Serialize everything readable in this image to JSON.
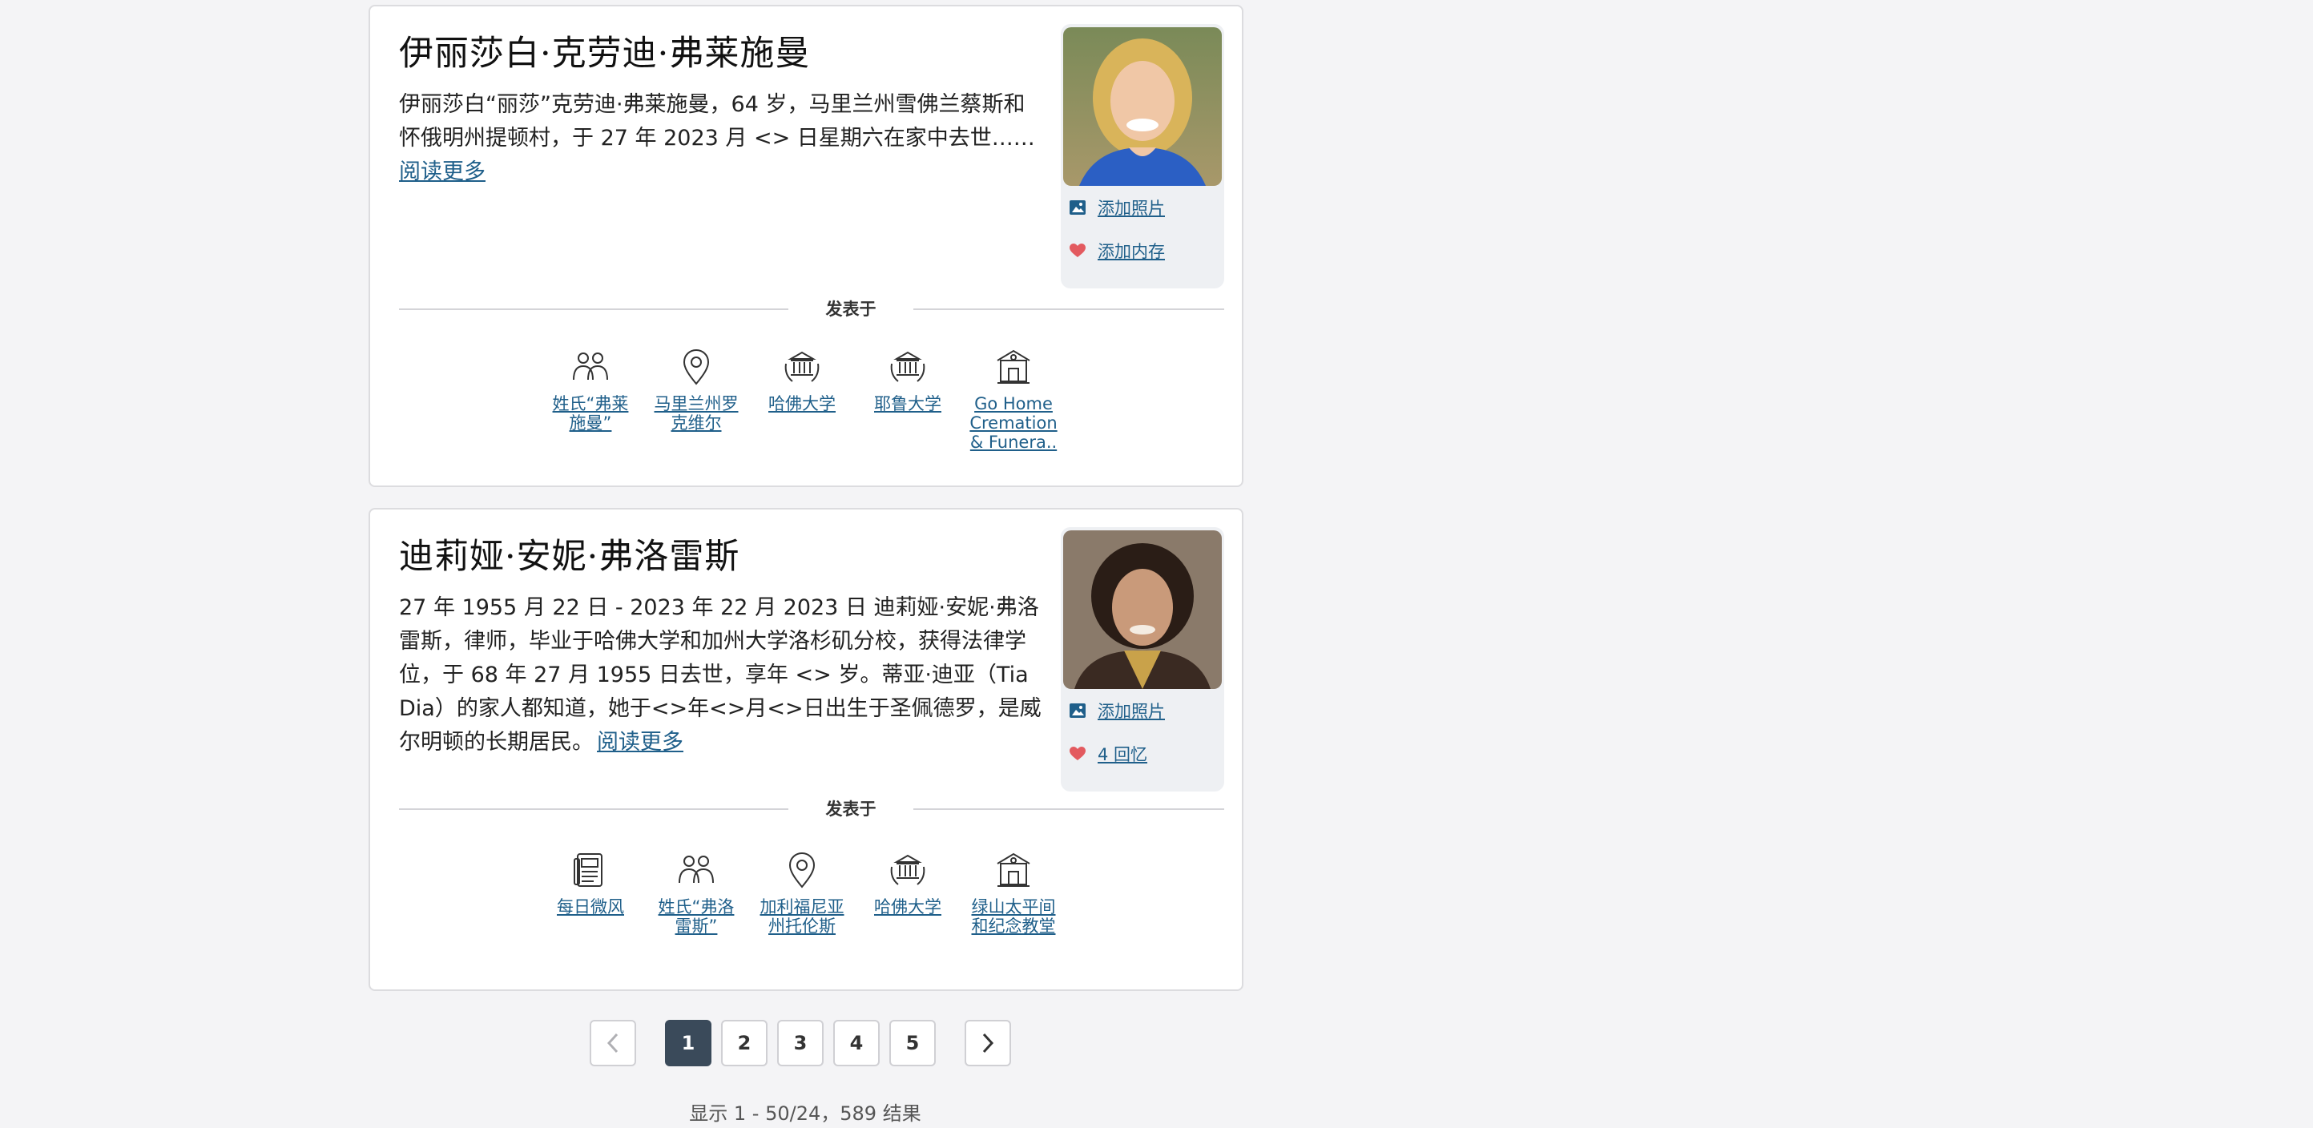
{
  "cards": [
    {
      "name": "伊丽莎白·克劳迪·弗莱施曼",
      "summary": "伊丽莎白“丽莎”克劳迪·弗莱施曼，64 岁，马里兰州雪佛兰蔡斯和怀俄明州提顿村，于 27 年 2023 月 <> 日星期六在家中去世……",
      "read_more": "阅读更多",
      "add_photo": "添加照片",
      "memories": "添加内存",
      "posted_in": "发表于",
      "posted_items": [
        {
          "icon": "people-icon",
          "label": "姓氏“弗莱施曼”"
        },
        {
          "icon": "location-pin-icon",
          "label": "马里兰州罗克维尔"
        },
        {
          "icon": "university-icon",
          "label": "哈佛大学"
        },
        {
          "icon": "university-icon",
          "label": "耶鲁大学"
        },
        {
          "icon": "funeral-home-icon",
          "label": "Go Home Cremation & Funera.."
        }
      ]
    },
    {
      "name": "迪莉娅·安妮·弗洛雷斯",
      "summary": "27 年 1955 月 22 日 - 2023 年 22 月 2023 日 迪莉娅·安妮·弗洛雷斯，律师，毕业于哈佛大学和加州大学洛杉矶分校，获得法律学位，于 68 年 27 月 1955 日去世，享年 <> 岁。蒂亚·迪亚（Tia Dia）的家人都知道，她于<>年<>月<>日出生于圣佩德罗，是威尔明顿的长期居民。",
      "read_more": "阅读更多",
      "add_photo": "添加照片",
      "memories": "4 回忆",
      "posted_in": "发表于",
      "posted_items": [
        {
          "icon": "newspaper-icon",
          "label": "每日微风"
        },
        {
          "icon": "people-icon",
          "label": "姓氏“弗洛雷斯”"
        },
        {
          "icon": "location-pin-icon",
          "label": "加利福尼亚州托伦斯"
        },
        {
          "icon": "university-icon",
          "label": "哈佛大学"
        },
        {
          "icon": "funeral-home-icon",
          "label": "绿山太平间和纪念教堂"
        }
      ]
    }
  ],
  "pagination": {
    "pages": [
      "1",
      "2",
      "3",
      "4",
      "5"
    ],
    "current": "1",
    "prev_icon": "chevron-left-icon",
    "next_icon": "chevron-right-icon"
  },
  "result_count": "显示 1 - 50/24，589 结果",
  "colors": {
    "link": "#1f5f8a",
    "heart": "#e35a5f",
    "active_page": "#3a4a5a"
  }
}
